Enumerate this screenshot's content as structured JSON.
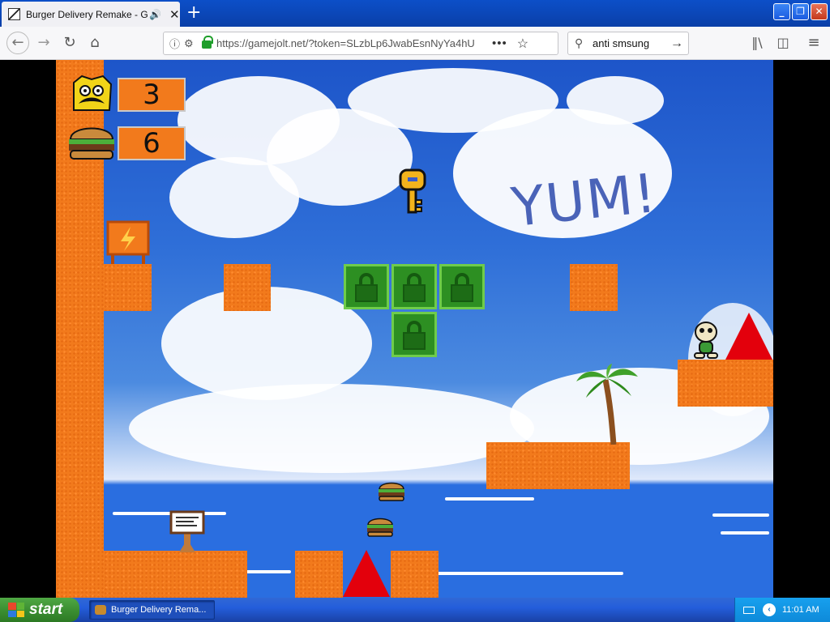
{
  "browser": {
    "tab_title": "Burger Delivery Remake - Gam",
    "tab_audio_icon": "speaker-icon",
    "tab_close": "✕",
    "new_tab": "+",
    "url": "https://gamejolt.net/?token=SLzbLp6JwabEsnNyYa4hU",
    "page_actions": "•••",
    "search_query": "anti smsung",
    "window_controls": {
      "minimize": "_",
      "maximize": "❐",
      "close": "✕"
    }
  },
  "game": {
    "hud": {
      "lives": "3",
      "burgers": "6"
    },
    "sky_text": "YUM!",
    "colors": {
      "block": "#f27a1c",
      "lock_block": "#2d8f22",
      "spike": "#e3000c",
      "sky": "#2f6fd8"
    },
    "icons": [
      "player-face-icon",
      "burger-icon",
      "key-icon",
      "lock-icon",
      "palm-tree-icon",
      "signpost-icon",
      "customer-icon",
      "spike-icon"
    ]
  },
  "taskbar": {
    "start_label": "start",
    "task_item": "Burger Delivery Rema...",
    "clock": "11:01 AM"
  }
}
